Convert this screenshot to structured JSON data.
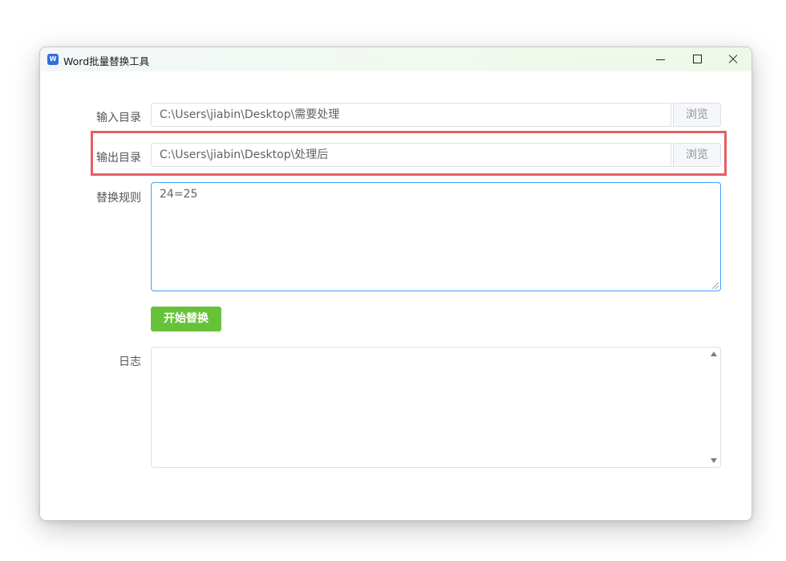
{
  "window": {
    "title": "Word批量替换工具",
    "app_icon_letter": "W",
    "controls": [
      "minimize-icon",
      "maximize-icon",
      "close-icon"
    ]
  },
  "form": {
    "input_dir": {
      "label": "输入目录",
      "value": "C:\\Users\\jiabin\\Desktop\\需要处理",
      "browse_label": "浏览"
    },
    "output_dir": {
      "label": "输出目录",
      "value": "C:\\Users\\jiabin\\Desktop\\处理后",
      "browse_label": "浏览"
    },
    "rules": {
      "label": "替换规则",
      "value": "24=25"
    },
    "start_button_label": "开始替换",
    "log": {
      "label": "日志",
      "value": ""
    }
  },
  "colors": {
    "highlight_border": "#e45e63",
    "start_button": "#67c23a",
    "focus_border": "#409eff",
    "app_icon": "#2f6fe4"
  }
}
